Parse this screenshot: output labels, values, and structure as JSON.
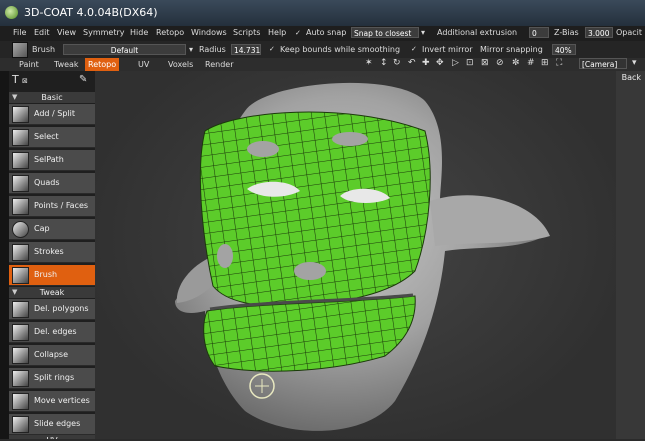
{
  "window": {
    "title": "3D-COAT 4.0.04B(DX64)"
  },
  "menu": {
    "items": [
      "File",
      "Edit",
      "View",
      "Symmetry",
      "Hide",
      "Retopo",
      "Windows",
      "Scripts",
      "Help"
    ],
    "auto_snap": "Auto snap",
    "snap_mode": "Snap to closest",
    "additional_extrusion": "Additional extrusion",
    "extrusion_value": "0",
    "zbias_label": "Z-Bias",
    "zbias_value": "3.000",
    "opacity_label": "Opacit"
  },
  "toolrow": {
    "brush_label": "Brush",
    "preset": "Default",
    "radius_label": "Radius",
    "radius_value": "14.731",
    "keep_bounds": "Keep bounds while smoothing",
    "invert_mirror": "Invert mirror",
    "mirror_snapping": "Mirror snapping",
    "mirror_value": "40%"
  },
  "tabs": [
    "Paint",
    "Tweak",
    "Retopo",
    "UV",
    "Voxels",
    "Render"
  ],
  "active_tab": "Retopo",
  "camera_label": "[Camera]",
  "viewport": {
    "back_label": "Back"
  },
  "panel": {
    "sections": [
      "Basic",
      "Tweak",
      "UV"
    ],
    "basic_tools": [
      "Add / Split",
      "Select",
      "SelPath",
      "Quads",
      "Points / Faces",
      "Cap",
      "Strokes",
      "Brush"
    ],
    "tweak_tools": [
      "Del. polygons",
      "Del. edges",
      "Collapse",
      "Split rings",
      "Move vertices",
      "Slide edges"
    ],
    "active_tool": "Brush"
  },
  "colors": {
    "accent": "#e06010",
    "retopo_mesh": "#5ccc2a",
    "sculpt": "#9a9a9a"
  }
}
